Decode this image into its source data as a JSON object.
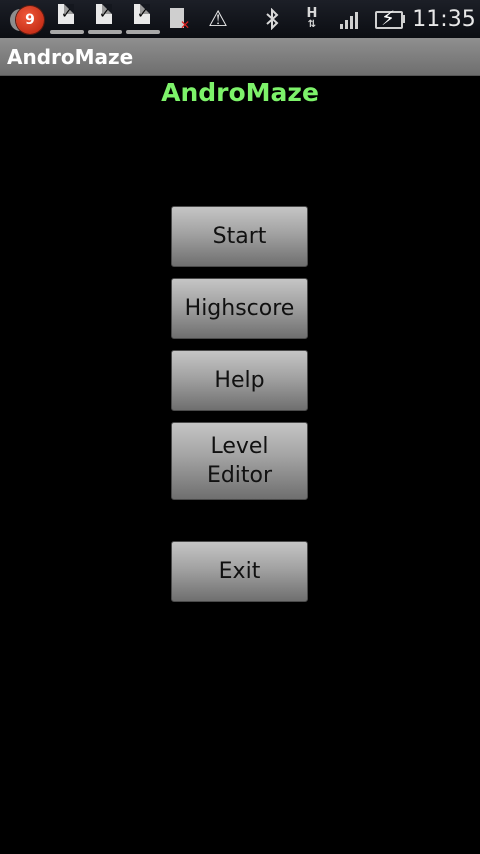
{
  "status_bar": {
    "notification_count": "9",
    "clock": "11:35",
    "icons": [
      "notification-badge-icon",
      "task-done-icon",
      "task-done-icon",
      "task-done-icon",
      "sd-card-error-icon",
      "warning-icon",
      "bluetooth-icon",
      "hspa-data-icon",
      "signal-strength-icon",
      "battery-charging-icon"
    ],
    "network_type": "H"
  },
  "title_bar": {
    "title": "AndroMaze"
  },
  "main": {
    "heading": "AndroMaze",
    "buttons": [
      {
        "label": "Start"
      },
      {
        "label": "Highscore"
      },
      {
        "label": "Help"
      },
      {
        "label": "Level\nEditor"
      },
      {
        "label": "Exit"
      }
    ]
  },
  "colors": {
    "heading": "#7df26a",
    "title_bar": "#7e7e7e",
    "background": "#000000",
    "notification_badge": "#d9331a"
  }
}
